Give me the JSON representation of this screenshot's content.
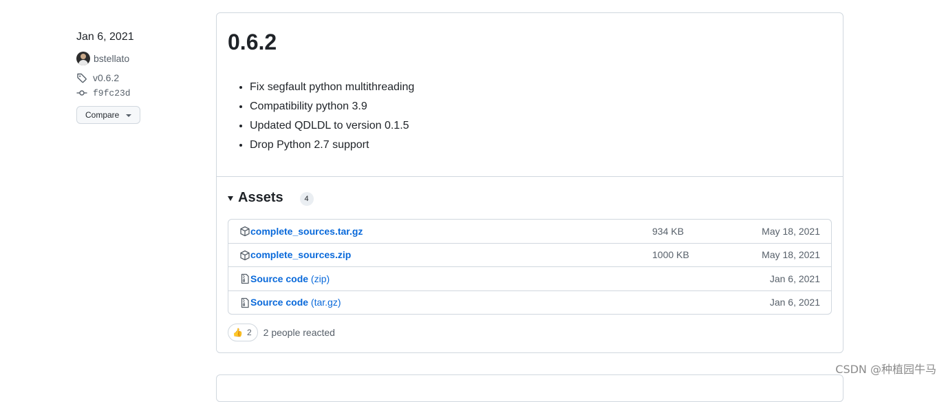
{
  "release_meta": {
    "date": "Jan 6, 2021",
    "author": "bstellato",
    "tag": "v0.6.2",
    "commit": "f9fc23d",
    "compare_label": "Compare"
  },
  "release": {
    "version": "0.6.2",
    "notes": [
      "Fix segfault python multithreading",
      "Compatibility python 3.9",
      "Updated QDLDL to version 0.1.5",
      "Drop Python 2.7 support"
    ],
    "assets_title": "Assets",
    "assets_count": "4",
    "assets": [
      {
        "name": "complete_sources.tar.gz",
        "suffix": "",
        "size": "934 KB",
        "date": "May 18, 2021",
        "icon": "package-icon"
      },
      {
        "name": "complete_sources.zip",
        "suffix": "",
        "size": "1000 KB",
        "date": "May 18, 2021",
        "icon": "package-icon"
      },
      {
        "name": "Source code",
        "suffix": " (zip)",
        "size": "",
        "date": "Jan 6, 2021",
        "icon": "file-zip-icon"
      },
      {
        "name": "Source code",
        "suffix": " (tar.gz)",
        "size": "",
        "date": "Jan 6, 2021",
        "icon": "file-zip-icon"
      }
    ],
    "reaction": {
      "emoji": "👍",
      "count": "2",
      "text": "2 people reacted"
    }
  },
  "watermark": "CSDN @种植园牛马",
  "colors": {
    "link": "#0969da",
    "muted": "#57606a",
    "border": "#d0d7de"
  }
}
